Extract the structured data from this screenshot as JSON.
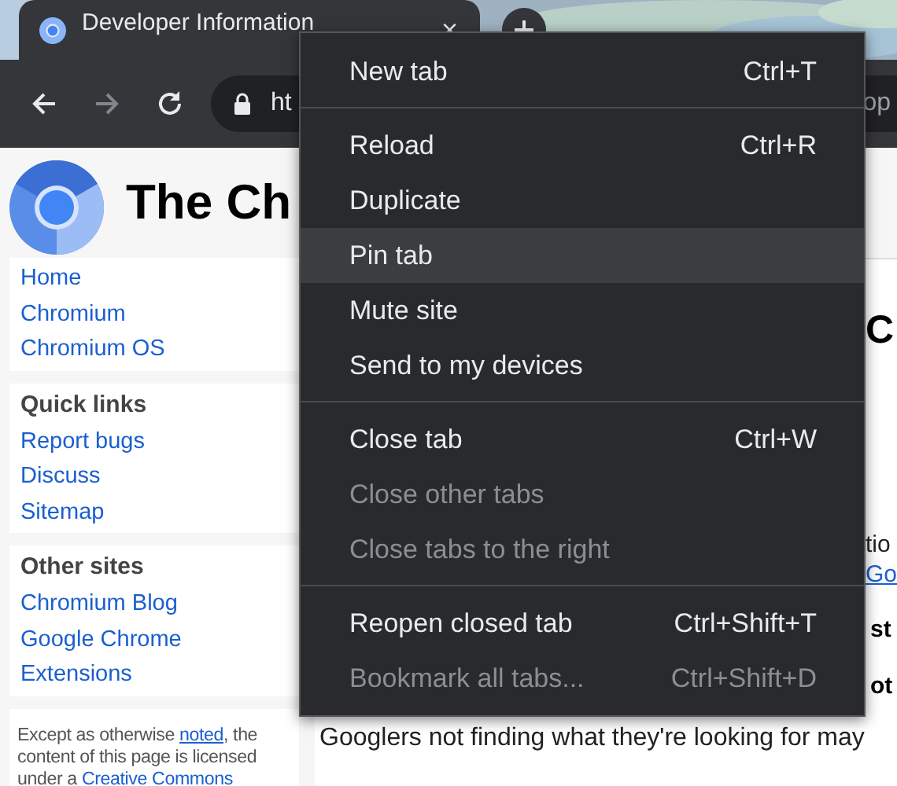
{
  "tab": {
    "title": "Developer Information",
    "close": "×"
  },
  "toolbar": {
    "back_disabled": false,
    "forward_disabled": true,
    "url_start": "ht",
    "url_end": "op"
  },
  "page": {
    "title": "The Ch",
    "nav": [
      {
        "links": [
          "Home",
          "Chromium",
          "Chromium OS"
        ]
      },
      {
        "heading": "Quick links",
        "links": [
          "Report bugs",
          "Discuss",
          "Sitemap"
        ]
      },
      {
        "heading": "Other sites",
        "links": [
          "Chromium Blog",
          "Google Chrome Extensions"
        ]
      }
    ],
    "license": {
      "before": "Except as otherwise ",
      "link1": "noted",
      "middle": ", the content of this page is licensed under a ",
      "link2": "Creative Commons"
    },
    "content": [
      {
        "kind": "heading",
        "text": "C"
      },
      {
        "kind": "text",
        "text": "tio"
      },
      {
        "kind": "link",
        "text": "Go"
      },
      {
        "kind": "bold",
        "text": "st"
      },
      {
        "kind": "bold",
        "text": "ot"
      },
      {
        "kind": "line",
        "text": "Googlers not finding what they're looking for may"
      }
    ]
  },
  "menu": [
    {
      "kind": "item",
      "label": "New tab",
      "shortcut": "Ctrl+T",
      "selected": false,
      "disabled": false
    },
    {
      "kind": "separator"
    },
    {
      "kind": "item",
      "label": "Reload",
      "shortcut": "Ctrl+R",
      "selected": false,
      "disabled": false
    },
    {
      "kind": "item",
      "label": "Duplicate",
      "selected": false,
      "disabled": false
    },
    {
      "kind": "item",
      "label": "Pin tab",
      "selected": true,
      "disabled": false
    },
    {
      "kind": "item",
      "label": "Mute site",
      "selected": false,
      "disabled": false
    },
    {
      "kind": "item",
      "label": "Send to my devices",
      "selected": false,
      "disabled": false
    },
    {
      "kind": "separator"
    },
    {
      "kind": "item",
      "label": "Close tab",
      "shortcut": "Ctrl+W",
      "selected": false,
      "disabled": false
    },
    {
      "kind": "item",
      "label": "Close other tabs",
      "selected": false,
      "disabled": true
    },
    {
      "kind": "item",
      "label": "Close tabs to the right",
      "selected": false,
      "disabled": true
    },
    {
      "kind": "separator"
    },
    {
      "kind": "item",
      "label": "Reopen closed tab",
      "shortcut": "Ctrl+Shift+T",
      "selected": false,
      "disabled": false
    },
    {
      "kind": "item",
      "label": "Bookmark all tabs...",
      "shortcut": "Ctrl+Shift+D",
      "selected": false,
      "disabled": true
    }
  ]
}
